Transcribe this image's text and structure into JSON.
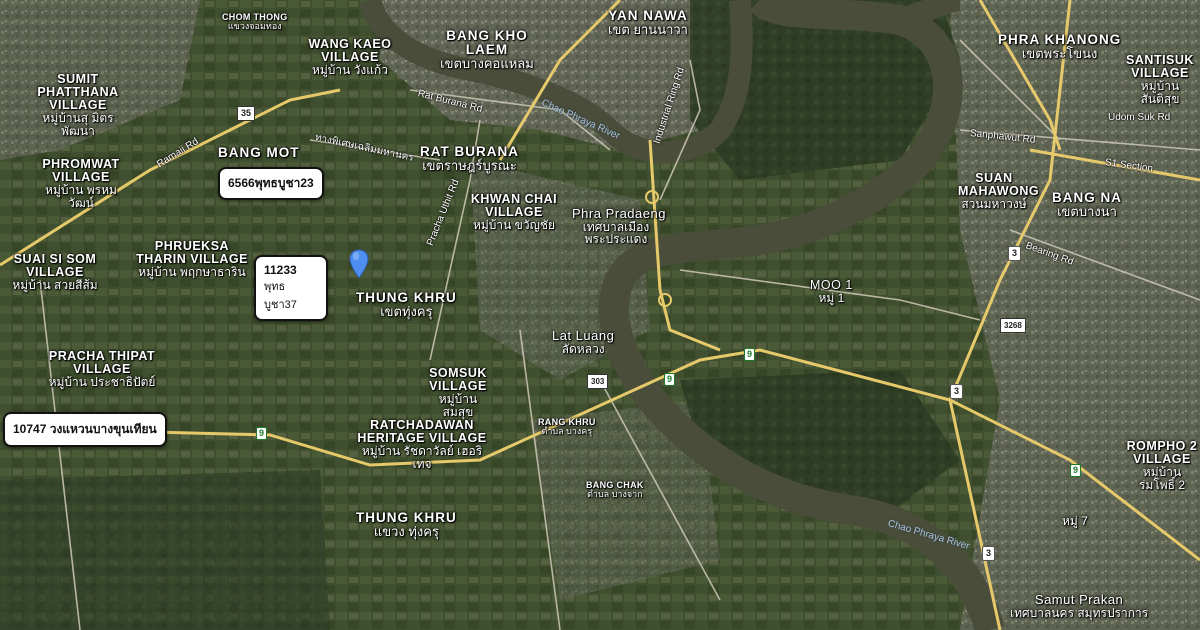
{
  "colors": {
    "river": "#4a4d3a",
    "road_major": "#e6c96a",
    "road_minor": "#cfc9b8",
    "pin": "#4f8ff0",
    "label_text": "#ffffff"
  },
  "places": [
    {
      "id": "chom-thong",
      "en": "CHOM THONG",
      "th": "แขวงจอมทอง"
    },
    {
      "id": "wang-kaeo",
      "en": "WANG KAEO VILLAGE",
      "th": "หมู่บ้าน วังแก้ว"
    },
    {
      "id": "bang-kho-laem",
      "en": "BANG KHO LAEM",
      "th": "เขตบางคอแหลม"
    },
    {
      "id": "yan-nawa",
      "en": "YAN NAWA",
      "th": "เขต ยานนาวา"
    },
    {
      "id": "phra-khanong",
      "en": "PHRA KHANONG",
      "th": "เขตพระโขนง"
    },
    {
      "id": "santisuk",
      "en": "SANTISUK VILLAGE",
      "th": "หมู่บ้าน สันติสุข"
    },
    {
      "id": "sumit",
      "en": "SUMIT PHATTHANA VILLAGE",
      "th": "หมู่บ้านสุ มิตรพัฒนา"
    },
    {
      "id": "bang-mot",
      "en": "BANG MOT",
      "th": ""
    },
    {
      "id": "rat-burana",
      "en": "RAT BURANA",
      "th": "เขตราษฎร์บูรณะ"
    },
    {
      "id": "phromwat",
      "en": "PHROMWAT VILLAGE",
      "th": "หมู่บ้าน พรหมวัฒน์"
    },
    {
      "id": "khwan-chai",
      "en": "KHWAN CHAI VILLAGE",
      "th": "หมู่บ้าน ขวัญชัย"
    },
    {
      "id": "phra-pradaeng",
      "en": "Phra Pradaeng",
      "th": "เทศบาลเมือง พระประแดง"
    },
    {
      "id": "suan-mahawong",
      "en": "SUAN MAHAWONG",
      "th": "สวนมหาวงษ์"
    },
    {
      "id": "bang-na",
      "en": "BANG NA",
      "th": "เขตบางนา"
    },
    {
      "id": "suai-si-som",
      "en": "SUAI SI SOM VILLAGE",
      "th": "หมู่บ้าน สวยสีส้ม"
    },
    {
      "id": "phrueksa",
      "en": "PHRUEKSA THARIN VILLAGE",
      "th": "หมู่บ้าน พฤกษาธาริน"
    },
    {
      "id": "thung-khru",
      "en": "THUNG KHRU",
      "th": "เขตทุ่งครุ"
    },
    {
      "id": "moo-1",
      "en": "MOO 1",
      "th": "หมู่ 1"
    },
    {
      "id": "lat-luang",
      "en": "Lat Luang",
      "th": "ลัดหลวง"
    },
    {
      "id": "pracha-thipat",
      "en": "PRACHA THIPAT VILLAGE",
      "th": "หมู่บ้าน ประชาธิปัตย์"
    },
    {
      "id": "somsuk",
      "en": "SOMSUK VILLAGE",
      "th": "หมู่บ้าน สมสุข"
    },
    {
      "id": "rang-khru",
      "en": "RANG KHRU",
      "th": "ตำบล บางครุ"
    },
    {
      "id": "ratchadawan",
      "en": "RATCHADAWAN HERITAGE VILLAGE",
      "th": "หมู่บ้าน รัชดาวัลย์ เฮอริเทจ"
    },
    {
      "id": "bang-chak",
      "en": "BANG CHAK",
      "th": "ตำบล บางจาก"
    },
    {
      "id": "thung-khru-2",
      "en": "THUNG KHRU",
      "th": "แขวง ทุ่งครุ"
    },
    {
      "id": "rompho",
      "en": "ROMPHO 2 VILLAGE",
      "th": "หมู่บ้าน ร่มโพธิ์ 2"
    },
    {
      "id": "moo-7",
      "en": "",
      "th": "หมู่ 7"
    },
    {
      "id": "samut-prakan",
      "en": "Samut Prakan",
      "th": "เทศบาลนคร สมุทรปราการ"
    }
  ],
  "roads": {
    "ramaii": "Ramaii Rd",
    "rat_burana": "Rat Burana Rd",
    "industrial_ring": "Industrial Ring Rd",
    "udom_suk": "Udom Suk Rd",
    "sanphawut": "Sanphawut Rd",
    "s1_section": "S1 Section",
    "bearing": "Bearing Rd",
    "pracha_uthit": "Pracha Uthit Rd",
    "thai_road": "ทางพิเศษเฉลิมมหานคร"
  },
  "rivers": {
    "chao_phraya_1": "Chao Phraya River",
    "chao_phraya_2": "Chao Phraya River"
  },
  "shields": {
    "s35": "35",
    "s3a": "3",
    "s3b": "3",
    "s3c": "3",
    "s3268": "3268",
    "s303": "303",
    "s9a": "9",
    "s9b": "9",
    "s9c": "9",
    "s9d": "9"
  },
  "callouts": [
    {
      "id": "c6566",
      "line1": "6566พุทธบูชา23",
      "line2": ""
    },
    {
      "id": "c11233",
      "line1": "11233",
      "line2": "พุทธบูชา37"
    },
    {
      "id": "c10747",
      "line1": "10747 วงแหวนบางขุนเทียน",
      "line2": ""
    }
  ]
}
